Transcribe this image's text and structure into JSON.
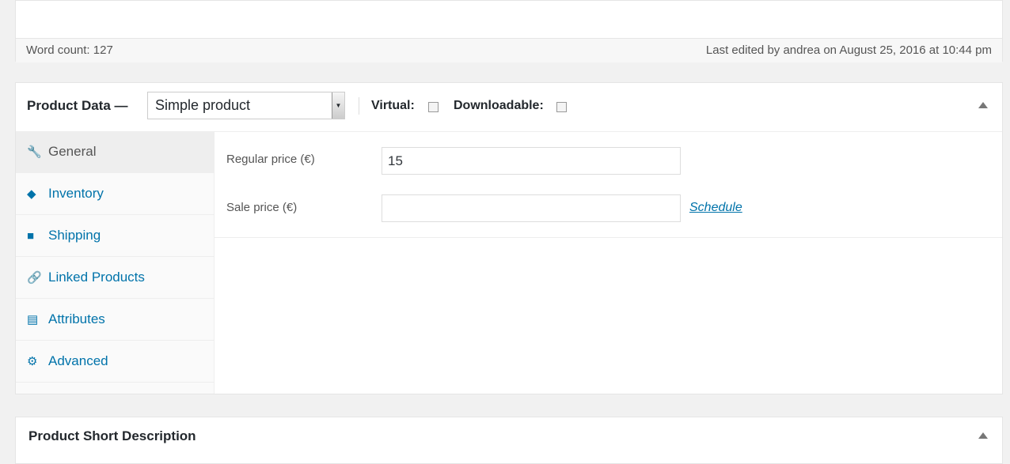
{
  "editor": {
    "word_count": "Word count: 127",
    "last_edited": "Last edited by andrea on August 25, 2016 at 10:44 pm"
  },
  "product_data": {
    "title": "Product Data —",
    "type_select": "Simple product",
    "virtual_label": "Virtual:",
    "virtual_checked": false,
    "downloadable_label": "Downloadable:",
    "downloadable_checked": false,
    "tabs": [
      {
        "label": "General",
        "icon": "wrench-icon",
        "glyph": "🔧"
      },
      {
        "label": "Inventory",
        "icon": "tag-icon",
        "glyph": "◆"
      },
      {
        "label": "Shipping",
        "icon": "truck-icon",
        "glyph": "■"
      },
      {
        "label": "Linked Products",
        "icon": "link-icon",
        "glyph": "🔗"
      },
      {
        "label": "Attributes",
        "icon": "list-icon",
        "glyph": "▤"
      },
      {
        "label": "Advanced",
        "icon": "gear-icon",
        "glyph": "⚙"
      }
    ],
    "regular_price_label": "Regular price (€)",
    "regular_price_value": "15",
    "sale_price_label": "Sale price (€)",
    "sale_price_value": "",
    "schedule_link": "Schedule"
  },
  "short_description": {
    "title": "Product Short Description"
  }
}
